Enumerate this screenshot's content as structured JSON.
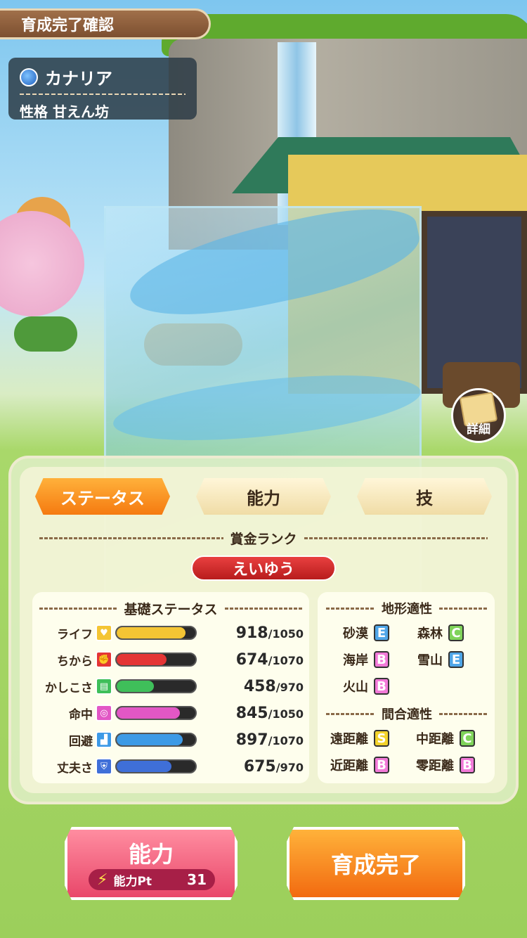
{
  "header": {
    "title": "育成完了確認",
    "name": "カナリア",
    "personality": "性格 甘えん坊"
  },
  "detail_button": {
    "label": "詳細"
  },
  "tabs": [
    {
      "label": "ステータス",
      "active": true
    },
    {
      "label": "能力",
      "active": false
    },
    {
      "label": "技",
      "active": false
    }
  ],
  "bounty": {
    "heading": "賞金ランク",
    "rank": "えいゆう"
  },
  "base_status": {
    "heading": "基礎ステータス",
    "rows": [
      {
        "label": "ライフ",
        "icon": "heart-icon",
        "color": "#f4c534",
        "value": "918",
        "max": "/1050",
        "fill": 0.874
      },
      {
        "label": "ちから",
        "icon": "fist-icon",
        "color": "#e43535",
        "value": "674",
        "max": "/1070",
        "fill": 0.63
      },
      {
        "label": "かしこさ",
        "icon": "book-icon",
        "color": "#3fbf5a",
        "value": "458",
        "max": "/970",
        "fill": 0.472
      },
      {
        "label": "命中",
        "icon": "target-icon",
        "color": "#e257c5",
        "value": "845",
        "max": "/1050",
        "fill": 0.805
      },
      {
        "label": "回避",
        "icon": "boot-icon",
        "color": "#3d9ae6",
        "value": "897",
        "max": "/1070",
        "fill": 0.838
      },
      {
        "label": "丈夫さ",
        "icon": "shield-icon",
        "color": "#3f6fd8",
        "value": "675",
        "max": "/970",
        "fill": 0.696
      }
    ]
  },
  "terrain": {
    "heading": "地形適性",
    "items": [
      {
        "label": "砂漠",
        "grade": "E"
      },
      {
        "label": "森林",
        "grade": "C"
      },
      {
        "label": "海岸",
        "grade": "B"
      },
      {
        "label": "雪山",
        "grade": "E"
      },
      {
        "label": "火山",
        "grade": "B"
      }
    ]
  },
  "range": {
    "heading": "間合適性",
    "items": [
      {
        "label": "遠距離",
        "grade": "S"
      },
      {
        "label": "中距離",
        "grade": "C"
      },
      {
        "label": "近距離",
        "grade": "B"
      },
      {
        "label": "零距離",
        "grade": "B"
      }
    ]
  },
  "buttons": {
    "ability": "能力",
    "ability_pt_label": "能力Pt",
    "ability_pt_value": "31",
    "finish": "育成完了"
  }
}
